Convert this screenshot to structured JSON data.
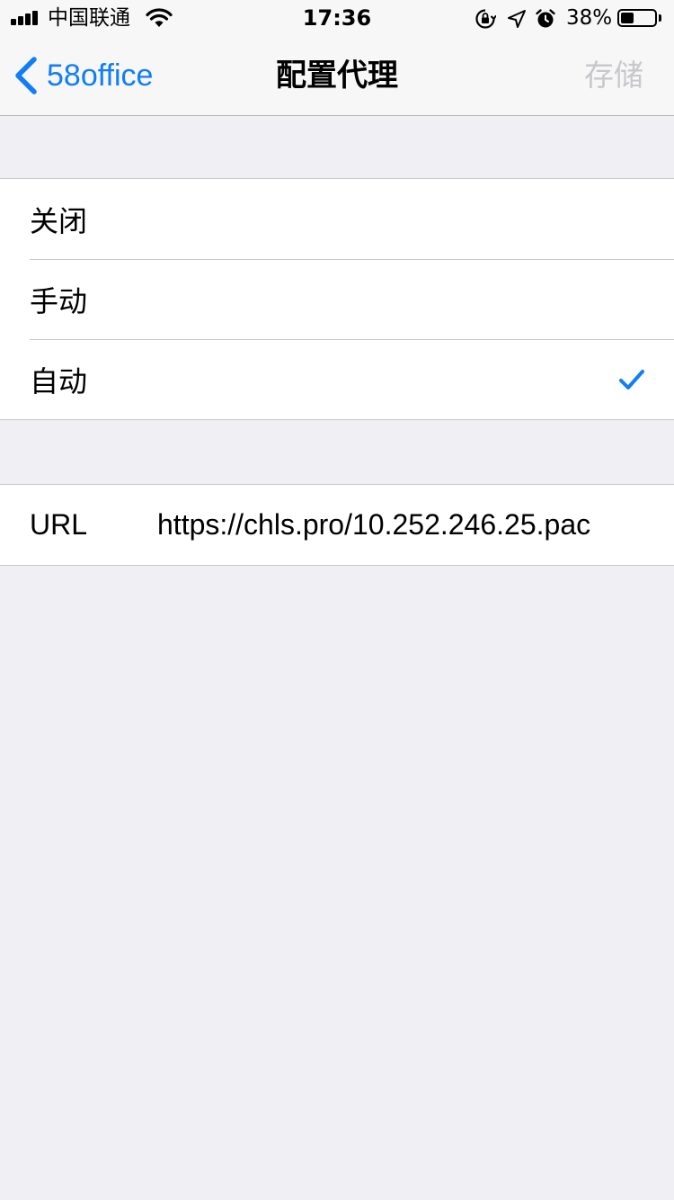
{
  "status_bar": {
    "carrier": "中国联通",
    "time": "17:36",
    "battery_percent": "38%",
    "battery_level": 0.38
  },
  "nav": {
    "back_label": "58office",
    "title": "配置代理",
    "save_label": "存储"
  },
  "proxy_modes": [
    {
      "label": "关闭",
      "selected": false
    },
    {
      "label": "手动",
      "selected": false
    },
    {
      "label": "自动",
      "selected": true
    }
  ],
  "url_field": {
    "label": "URL",
    "value": "https://chls.pro/10.252.246.25.pac"
  },
  "colors": {
    "accent": "#117ef6",
    "background": "#efeff4",
    "disabled": "#c7c7cc"
  },
  "icons": [
    "signal-icon",
    "wifi-icon",
    "orientation-lock-icon",
    "location-icon",
    "alarm-icon",
    "battery-icon",
    "chevron-left-icon",
    "checkmark-icon"
  ]
}
